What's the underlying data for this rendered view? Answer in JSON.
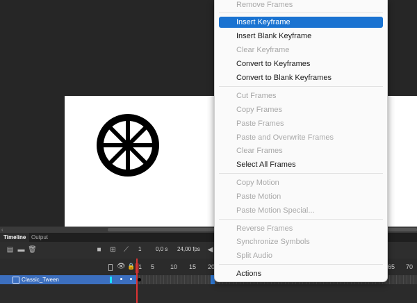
{
  "timeline": {
    "tabs": [
      {
        "label": "Timeline"
      },
      {
        "label": "Output"
      }
    ],
    "current_frame": "1",
    "time": "0,0 s",
    "fps": "24,00 fps",
    "ruler_ticks": [
      "1",
      "5",
      "10",
      "15",
      "20",
      "65",
      "70"
    ],
    "layer": {
      "name": "Classic_Tween"
    }
  },
  "context_menu": {
    "items": [
      {
        "label": "Remove Frames",
        "enabled": false
      },
      {
        "label": "Insert Keyframe",
        "enabled": true,
        "selected": true
      },
      {
        "label": "Insert Blank Keyframe",
        "enabled": true
      },
      {
        "label": "Clear Keyframe",
        "enabled": false
      },
      {
        "label": "Convert to Keyframes",
        "enabled": true
      },
      {
        "label": "Convert to Blank Keyframes",
        "enabled": true
      },
      {
        "label": "Cut Frames",
        "enabled": false
      },
      {
        "label": "Copy Frames",
        "enabled": false
      },
      {
        "label": "Paste Frames",
        "enabled": false
      },
      {
        "label": "Paste and Overwrite Frames",
        "enabled": false
      },
      {
        "label": "Clear Frames",
        "enabled": false
      },
      {
        "label": "Select All Frames",
        "enabled": true
      },
      {
        "label": "Copy Motion",
        "enabled": false
      },
      {
        "label": "Paste Motion",
        "enabled": false
      },
      {
        "label": "Paste Motion Special...",
        "enabled": false
      },
      {
        "label": "Reverse Frames",
        "enabled": false
      },
      {
        "label": "Synchronize Symbols",
        "enabled": false
      },
      {
        "label": "Split Audio",
        "enabled": false
      },
      {
        "label": "Actions",
        "enabled": true
      }
    ]
  },
  "colors": {
    "selection": "#1a73d1",
    "playhead": "#dd3333",
    "layer_selected": "#3c6fbf"
  },
  "icons": [
    "new-layer-icon",
    "new-folder-icon",
    "delete-icon",
    "camera-icon",
    "parent-view-icon",
    "graph-icon",
    "play-icon",
    "eye-icon",
    "lock-icon",
    "outline-icon",
    "layer-type-icon"
  ]
}
